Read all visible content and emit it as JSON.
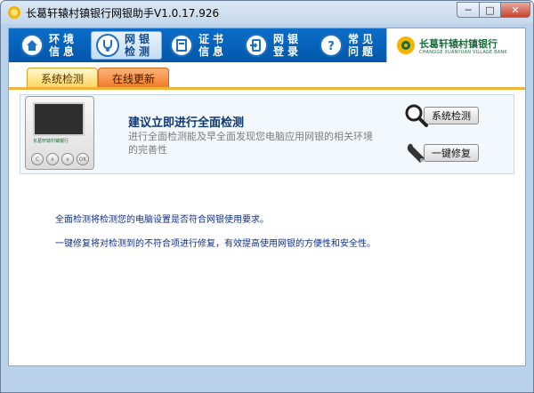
{
  "window": {
    "title": "长葛轩辕村镇银行网银助手V1.0.17.926",
    "minimize": "─",
    "maximize": "□",
    "close": "✕"
  },
  "nav": {
    "items": [
      {
        "line1": "环境",
        "line2": "信息",
        "icon": "home-icon"
      },
      {
        "line1": "网银",
        "line2": "检测",
        "icon": "stethoscope-icon"
      },
      {
        "line1": "证书",
        "line2": "信息",
        "icon": "certificate-icon"
      },
      {
        "line1": "网银",
        "line2": "登录",
        "icon": "login-icon"
      },
      {
        "line1": "常见",
        "line2": "问题",
        "icon": "question-icon"
      }
    ],
    "active_index": 1
  },
  "logo": {
    "name": "长葛轩辕村镇银行",
    "english": "CHANGGE XUANYUAN VILLAGE BANK"
  },
  "tabs": [
    {
      "label": "系统检测",
      "active": true
    },
    {
      "label": "在线更新",
      "active": false
    }
  ],
  "panel": {
    "heading": "建议立即进行全面检测",
    "desc_line1": "进行全面检测能及早全面发现您电脑应用网银的相关环境",
    "desc_line2": "的完善性",
    "device_bank": "长葛轩辕村镇银行",
    "device_buttons": [
      "C",
      "∧",
      "∨",
      "OK"
    ]
  },
  "actions": {
    "check": {
      "label": "系统检测",
      "icon": "magnifier-icon"
    },
    "repair": {
      "label": "一键修复",
      "icon": "wrench-icon"
    }
  },
  "info": {
    "line1": "全面检测将检测您的电脑设置是否符合网银使用要求。",
    "line2": "一键修复将对检测到的不符合项进行修复，有效提高使用网银的方便性和安全性。"
  },
  "colors": {
    "navbar": "#0560b8",
    "tab_active": "#ffd55a",
    "tab_inactive": "#ef7b22",
    "info_text": "#0f2f86",
    "heading": "#0d3876"
  }
}
